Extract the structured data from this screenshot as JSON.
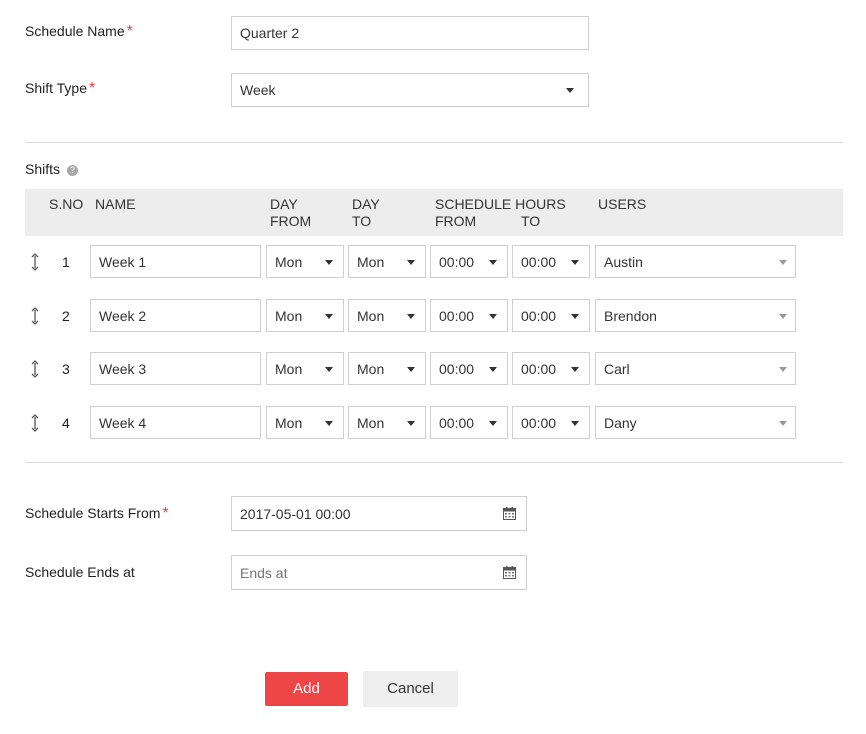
{
  "form": {
    "schedule_name_label": "Schedule Name",
    "schedule_name_value": "Quarter 2",
    "shift_type_label": "Shift Type",
    "shift_type_value": "Week",
    "required_mark": "*",
    "shifts_label": "Shifts",
    "starts_label": "Schedule Starts From",
    "starts_value": "2017-05-01 00:00",
    "ends_label": "Schedule Ends at",
    "ends_placeholder": "Ends at"
  },
  "table": {
    "headers": {
      "sno": "S.NO",
      "name": "NAME",
      "day_from_1": "DAY",
      "day_from_2": "FROM",
      "day_to_1": "DAY",
      "day_to_2": "TO",
      "hours_1": "SCHEDULE HOURS",
      "hours_from": "FROM",
      "hours_to": "TO",
      "users": "USERS"
    },
    "rows": [
      {
        "sno": "1",
        "name": "Week 1",
        "day_from": "Mon",
        "day_to": "Mon",
        "from": "00:00",
        "to": "00:00",
        "user": "Austin"
      },
      {
        "sno": "2",
        "name": "Week 2",
        "day_from": "Mon",
        "day_to": "Mon",
        "from": "00:00",
        "to": "00:00",
        "user": "Brendon"
      },
      {
        "sno": "3",
        "name": "Week 3",
        "day_from": "Mon",
        "day_to": "Mon",
        "from": "00:00",
        "to": "00:00",
        "user": "Carl"
      },
      {
        "sno": "4",
        "name": "Week 4",
        "day_from": "Mon",
        "day_to": "Mon",
        "from": "00:00",
        "to": "00:00",
        "user": "Dany"
      }
    ]
  },
  "buttons": {
    "add": "Add",
    "cancel": "Cancel"
  },
  "colors": {
    "accent": "#ee4646",
    "required": "#e94444",
    "header_bg": "#ededed"
  },
  "icons": {
    "help": "help-circle-icon",
    "calendar": "calendar-icon",
    "drag": "drag-handle-icon",
    "dropdown": "chevron-down-icon"
  }
}
